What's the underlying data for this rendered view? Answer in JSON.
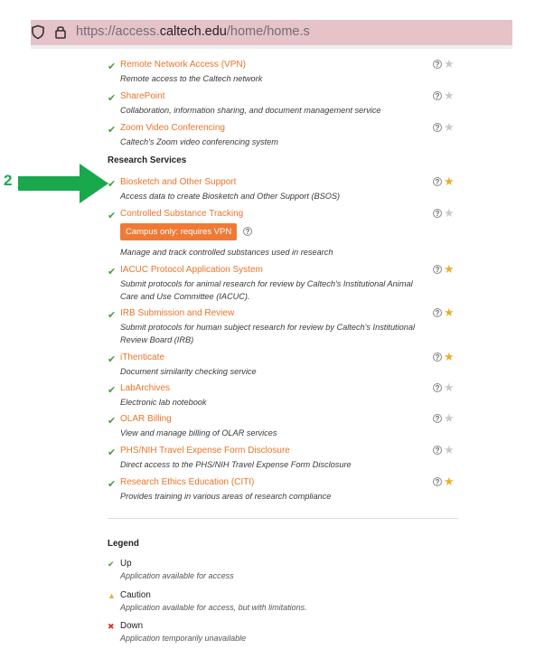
{
  "browser": {
    "url_prefix": "https://access.",
    "url_domain": "caltech.edu",
    "url_path": "/home/home.s"
  },
  "colors": {
    "link": "#e8742a",
    "check": "#4a9e3a",
    "star_on": "#e8b12e",
    "star_off": "#c9c9c9",
    "arrow": "#19a84c",
    "url_bar": "#e6c2c9"
  },
  "top_items": [
    {
      "name": "Remote Network Access (VPN)",
      "desc": "Remote access to the Caltech network",
      "favorite": false
    },
    {
      "name": "SharePoint",
      "desc": "Collaboration, information sharing, and document management service",
      "favorite": false
    },
    {
      "name": "Zoom Video Conferencing",
      "desc": "Caltech's Zoom video conferencing system",
      "favorite": false
    }
  ],
  "research": {
    "heading": "Research Services",
    "items": [
      {
        "name": "Biosketch and Other Support",
        "desc": "Access data to create Biosketch and Other Support (BSOS)",
        "favorite": true
      },
      {
        "name": "Controlled Substance Tracking",
        "badge": "Campus only: requires VPN",
        "desc": "Manage and track controlled substances used in research",
        "favorite": false
      },
      {
        "name": "IACUC Protocol Application System",
        "desc": "Submit protocols for animal research for review by Caltech's Institutional Animal Care and Use Committee (IACUC).",
        "favorite": true
      },
      {
        "name": "IRB Submission and Review",
        "desc": "Submit protocols for human subject research for review by Caltech's Institutional Review Board (IRB)",
        "favorite": true
      },
      {
        "name": "iThenticate",
        "desc": "Document similarity checking service",
        "favorite": true
      },
      {
        "name": "LabArchives",
        "desc": "Electronic lab notebook",
        "favorite": false
      },
      {
        "name": "OLAR Billing",
        "desc": "View and manage billing of OLAR services",
        "favorite": false
      },
      {
        "name": "PHS/NIH Travel Expense Form Disclosure",
        "desc": "Direct access to the PHS/NIH Travel Expense Form Disclosure",
        "favorite": false
      },
      {
        "name": "Research Ethics Education (CITI)",
        "desc": "Provides training in various areas of research compliance",
        "favorite": true
      }
    ]
  },
  "annotation": {
    "step": "2"
  },
  "legend": {
    "heading": "Legend",
    "items": [
      {
        "symbol": "✔",
        "color": "#4a9e3a",
        "title": "Up",
        "desc": "Application available for access"
      },
      {
        "symbol": "▲",
        "color": "#e8b12e",
        "title": "Caution",
        "desc": "Application available for access, but with limitations."
      },
      {
        "symbol": "✖",
        "color": "#d9362b",
        "title": "Down",
        "desc": "Application temporarily unavailable"
      }
    ]
  }
}
